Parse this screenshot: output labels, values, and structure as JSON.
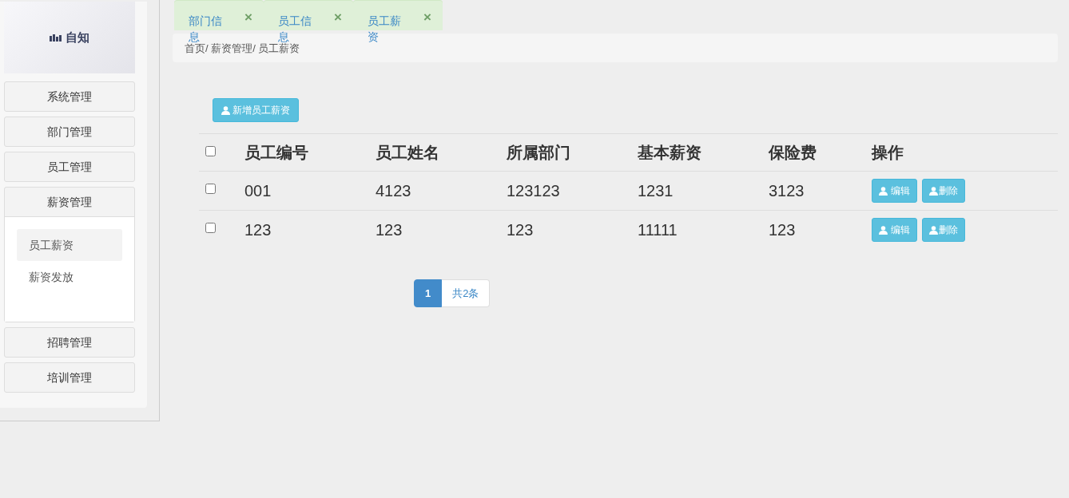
{
  "logo": {
    "text": "自知"
  },
  "sidebar": {
    "items": [
      {
        "label": "系统管理",
        "expanded": false
      },
      {
        "label": "部门管理",
        "expanded": false
      },
      {
        "label": "员工管理",
        "expanded": false
      },
      {
        "label": "薪资管理",
        "expanded": true,
        "children": [
          {
            "label": "员工薪资",
            "selected": true
          },
          {
            "label": "薪资发放",
            "selected": false
          }
        ]
      },
      {
        "label": "招聘管理",
        "expanded": false
      },
      {
        "label": "培训管理",
        "expanded": false
      }
    ]
  },
  "tabs": [
    {
      "label": "部门信息",
      "close": "×"
    },
    {
      "label": "员工信息",
      "close": "×"
    },
    {
      "label": "员工薪资",
      "close": "×"
    }
  ],
  "breadcrumb": [
    "首页/",
    "薪资管理/",
    "员工薪资"
  ],
  "add_button": "新增员工薪资",
  "table": {
    "columns": [
      "员工编号",
      "员工姓名",
      "所属部门",
      "基本薪资",
      "保险费",
      "操作"
    ],
    "header_checked": false,
    "rows": [
      {
        "checked": false,
        "cells": [
          "001",
          "4123",
          "123123",
          "1231",
          "3123"
        ],
        "actions": [
          "编辑",
          "删除"
        ]
      },
      {
        "checked": false,
        "cells": [
          "123",
          "123",
          "123",
          "11111",
          "123"
        ],
        "actions": [
          "编辑",
          "删除"
        ]
      }
    ]
  },
  "pagination": {
    "pages": [
      {
        "label": "1",
        "selected": true
      }
    ],
    "total": "共2条"
  }
}
